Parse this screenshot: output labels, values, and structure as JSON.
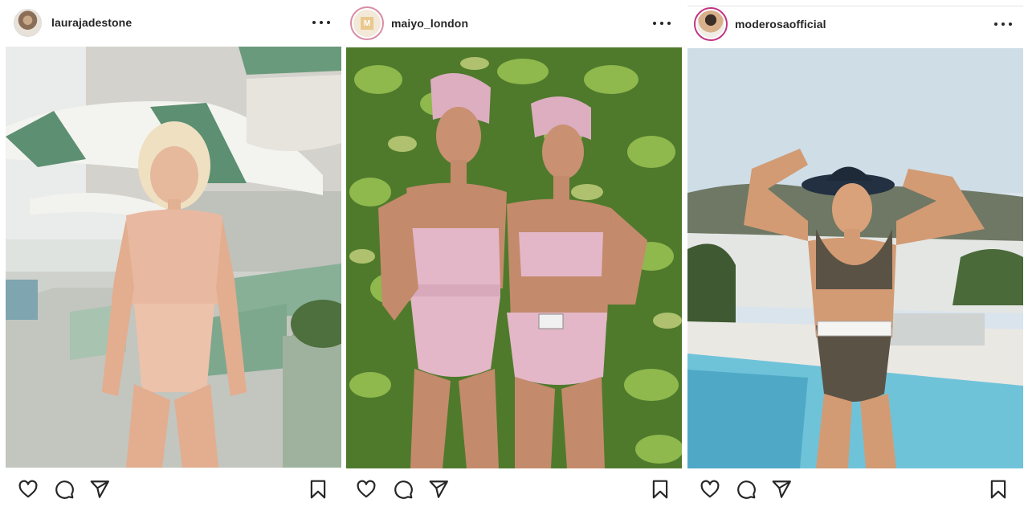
{
  "posts": [
    {
      "username": "laurajadestone",
      "avatar_icon": "profile-avatar",
      "photo": {
        "subject": "photo",
        "accent": "#e8b9a0"
      },
      "actions": {
        "like_icon": "heart-icon",
        "comment_icon": "comment-icon",
        "share_icon": "paper-plane-icon",
        "save_icon": "bookmark-icon"
      }
    },
    {
      "username": "maiyo_london",
      "avatar_icon": "brand-logo-avatar",
      "avatar_letter": "M",
      "photo": {
        "subject": "photo",
        "accent": "#e3b7c7"
      },
      "actions": {
        "like_icon": "heart-icon",
        "comment_icon": "comment-icon",
        "share_icon": "paper-plane-icon",
        "save_icon": "bookmark-icon"
      }
    },
    {
      "username": "moderosaofficial",
      "avatar_icon": "profile-avatar",
      "photo": {
        "subject": "photo",
        "accent": "#5a5345"
      },
      "actions": {
        "like_icon": "heart-icon",
        "comment_icon": "comment-icon",
        "share_icon": "paper-plane-icon",
        "save_icon": "bookmark-icon"
      }
    }
  ],
  "colors": {
    "text": "#262626",
    "story_ring": "#c13584",
    "background": "#ffffff"
  }
}
